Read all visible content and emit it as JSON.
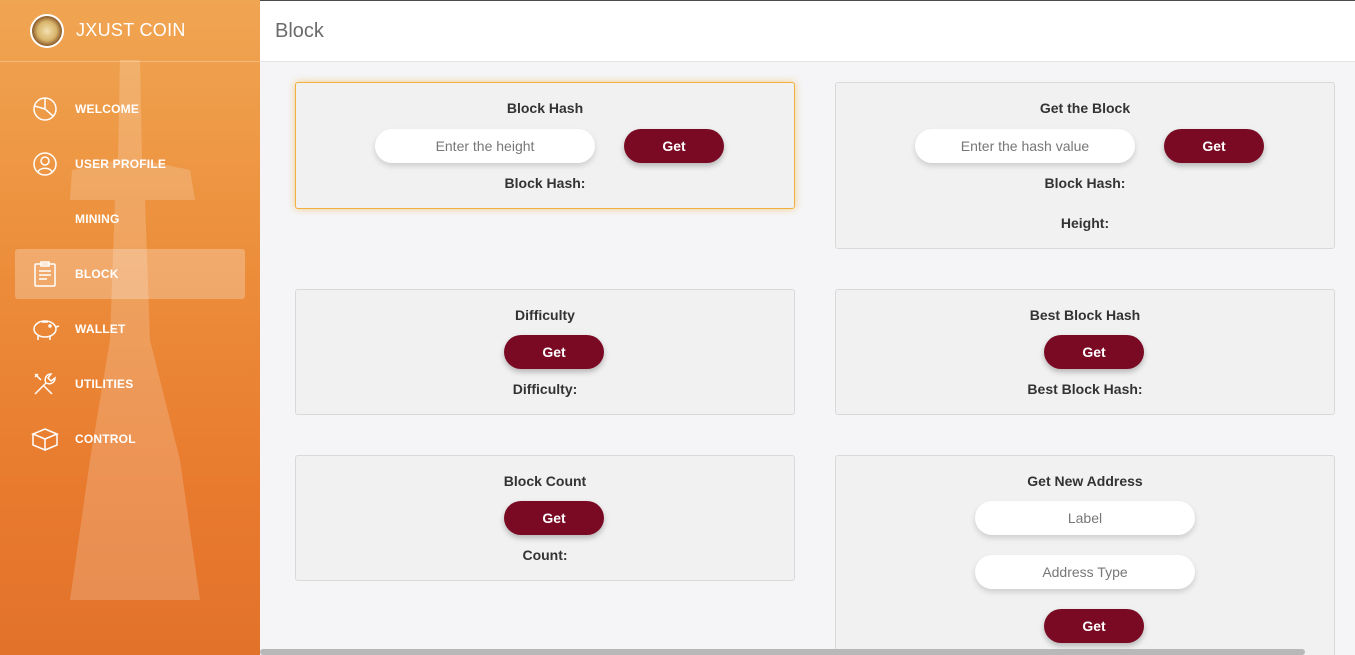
{
  "brand": {
    "name": "JXUST COIN"
  },
  "sidebar": {
    "items": [
      {
        "label": "WELCOME",
        "icon": "pie-chart-icon"
      },
      {
        "label": "USER PROFILE",
        "icon": "user-icon"
      },
      {
        "label": "MINING",
        "icon": ""
      },
      {
        "label": "BLOCK",
        "icon": "clipboard-icon",
        "active": true
      },
      {
        "label": "WALLET",
        "icon": "piggy-bank-icon"
      },
      {
        "label": "UTILITIES",
        "icon": "tools-icon"
      },
      {
        "label": "CONTROL",
        "icon": "cube-icon"
      }
    ]
  },
  "header": {
    "title": "Block"
  },
  "cards": {
    "block_hash": {
      "title": "Block Hash",
      "input_placeholder": "Enter the height",
      "button": "Get",
      "result_label": "Block Hash:"
    },
    "get_block": {
      "title": "Get the Block",
      "input_placeholder": "Enter the hash value",
      "button": "Get",
      "result_hash_label": "Block Hash:",
      "result_height_label": "Height:"
    },
    "difficulty": {
      "title": "Difficulty",
      "button": "Get",
      "result_label": "Difficulty:"
    },
    "best_block_hash": {
      "title": "Best Block Hash",
      "button": "Get",
      "result_label": "Best Block Hash:"
    },
    "block_count": {
      "title": "Block Count",
      "button": "Get",
      "result_label": "Count:"
    },
    "new_address": {
      "title": "Get New Address",
      "label_placeholder": "Label",
      "type_placeholder": "Address Type",
      "button": "Get"
    }
  },
  "colors": {
    "accent": "#7a0a24",
    "sidebar_top": "#f0a552",
    "sidebar_bottom": "#e2722a",
    "focus": "#f0b040"
  }
}
